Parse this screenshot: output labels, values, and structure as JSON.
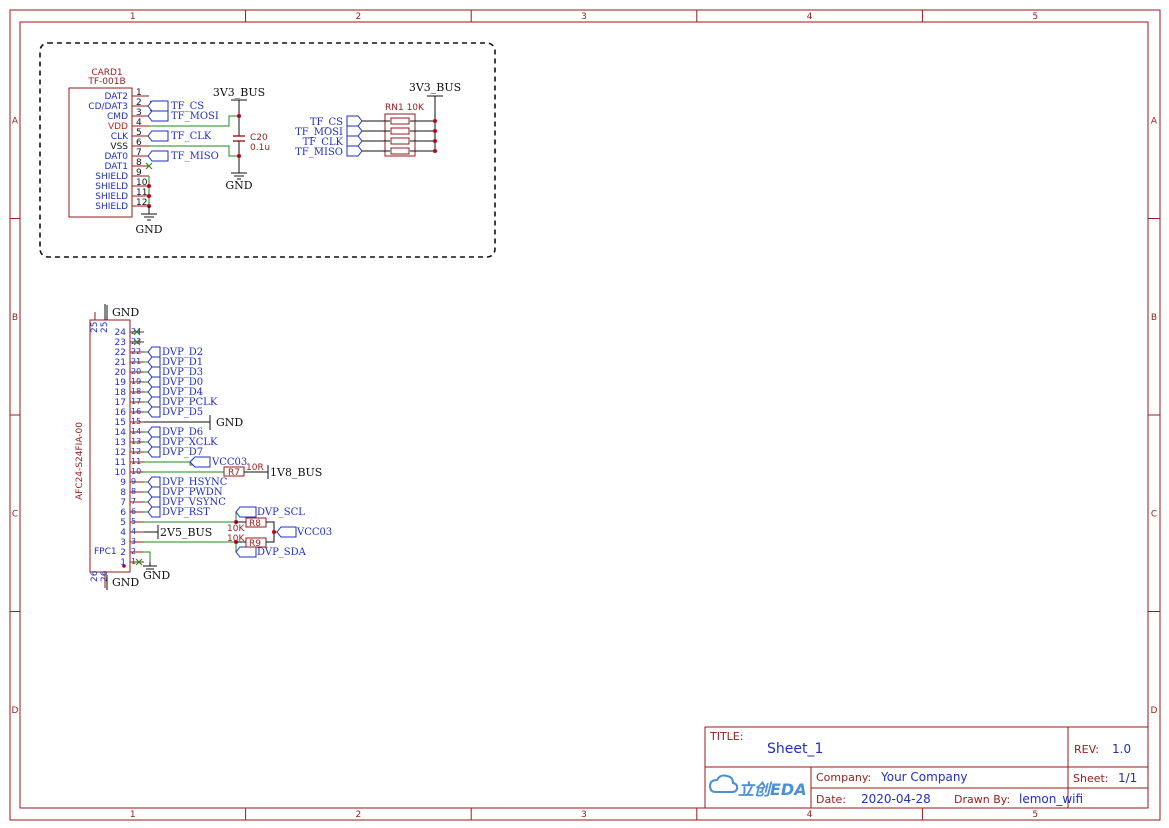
{
  "frame": {
    "columns": [
      "1",
      "2",
      "3",
      "4",
      "5"
    ],
    "rows": [
      "A",
      "B",
      "C",
      "D"
    ]
  },
  "sd_card": {
    "designator": "CARD1",
    "part": "TF-001B",
    "pins": [
      {
        "num": "1",
        "name": "DAT2",
        "color": "blue"
      },
      {
        "num": "2",
        "name": "CD/DAT3",
        "color": "blue"
      },
      {
        "num": "3",
        "name": "CMD",
        "color": "blue"
      },
      {
        "num": "4",
        "name": "VDD",
        "color": "red"
      },
      {
        "num": "5",
        "name": "CLK",
        "color": "blue"
      },
      {
        "num": "6",
        "name": "VSS",
        "color": "black"
      },
      {
        "num": "7",
        "name": "DAT0",
        "color": "blue"
      },
      {
        "num": "8",
        "name": "DAT1",
        "color": "blue"
      },
      {
        "num": "9",
        "name": "SHIELD",
        "color": "blue"
      },
      {
        "num": "10",
        "name": "SHIELD",
        "color": "blue"
      },
      {
        "num": "11",
        "name": "SHIELD",
        "color": "blue"
      },
      {
        "num": "12",
        "name": "SHIELD",
        "color": "blue"
      }
    ],
    "nets": [
      "TF_CS",
      "TF_MOSI",
      "TF_CLK",
      "TF_MISO"
    ],
    "gnd": "GND"
  },
  "cap": {
    "designator": "C20",
    "value": "0.1u",
    "power": "3V3_BUS",
    "gnd": "GND"
  },
  "rn": {
    "designator": "RN1 10K",
    "power": "3V3_BUS",
    "nets": [
      "TF_CS",
      "TF_MOSI",
      "TF_CLK",
      "TF_MISO"
    ]
  },
  "fpc": {
    "designator": "FPC1",
    "part": "AFC24-S24FIA-00",
    "gnd_top": "GND",
    "gnd_bottom": "GND",
    "top_pins": [
      "25",
      "25"
    ],
    "bottom_pins": [
      "26",
      "26"
    ],
    "pin_numbers": [
      "24",
      "23",
      "22",
      "21",
      "20",
      "19",
      "18",
      "17",
      "16",
      "15",
      "14",
      "13",
      "12",
      "11",
      "10",
      "9",
      "8",
      "7",
      "6",
      "5",
      "4",
      "3",
      "2",
      "1"
    ],
    "net_labels": {
      "p22": "DVP_D2",
      "p21": "DVP_D1",
      "p20": "DVP_D3",
      "p19": "DVP_D0",
      "p18": "DVP_D4",
      "p17": "DVP_PCLK",
      "p16": "DVP_D5",
      "p15": "GND",
      "p14": "DVP_D6",
      "p13": "DVP_XCLK",
      "p12": "DVP_D7",
      "p11": "VCC03",
      "p9": "DVP_HSYNC",
      "p8": "DVP_PWDN",
      "p7": "DVP_VSYNC",
      "p6": "DVP_RST",
      "p4": "2V5_BUS",
      "p1": "GND"
    },
    "r7": {
      "designator": "R7",
      "value": "10R",
      "net": "1V8_BUS"
    },
    "r8": {
      "designator": "R8",
      "value": "10K",
      "net": "DVP_SCL"
    },
    "r9": {
      "designator": "R9",
      "value": "10K",
      "net": "DVP_SDA"
    },
    "pullup_power": "VCC03"
  },
  "title_block": {
    "title_label": "TITLE:",
    "title": "Sheet_1",
    "rev_label": "REV:",
    "rev": "1.0",
    "company_label": "Company:",
    "company": "Your Company",
    "sheet_label": "Sheet:",
    "sheet": "1/1",
    "date_label": "Date:",
    "date": "2020-04-28",
    "drawn_label": "Drawn By:",
    "drawn": "lemon_wifi",
    "logo": "立创EDA"
  }
}
